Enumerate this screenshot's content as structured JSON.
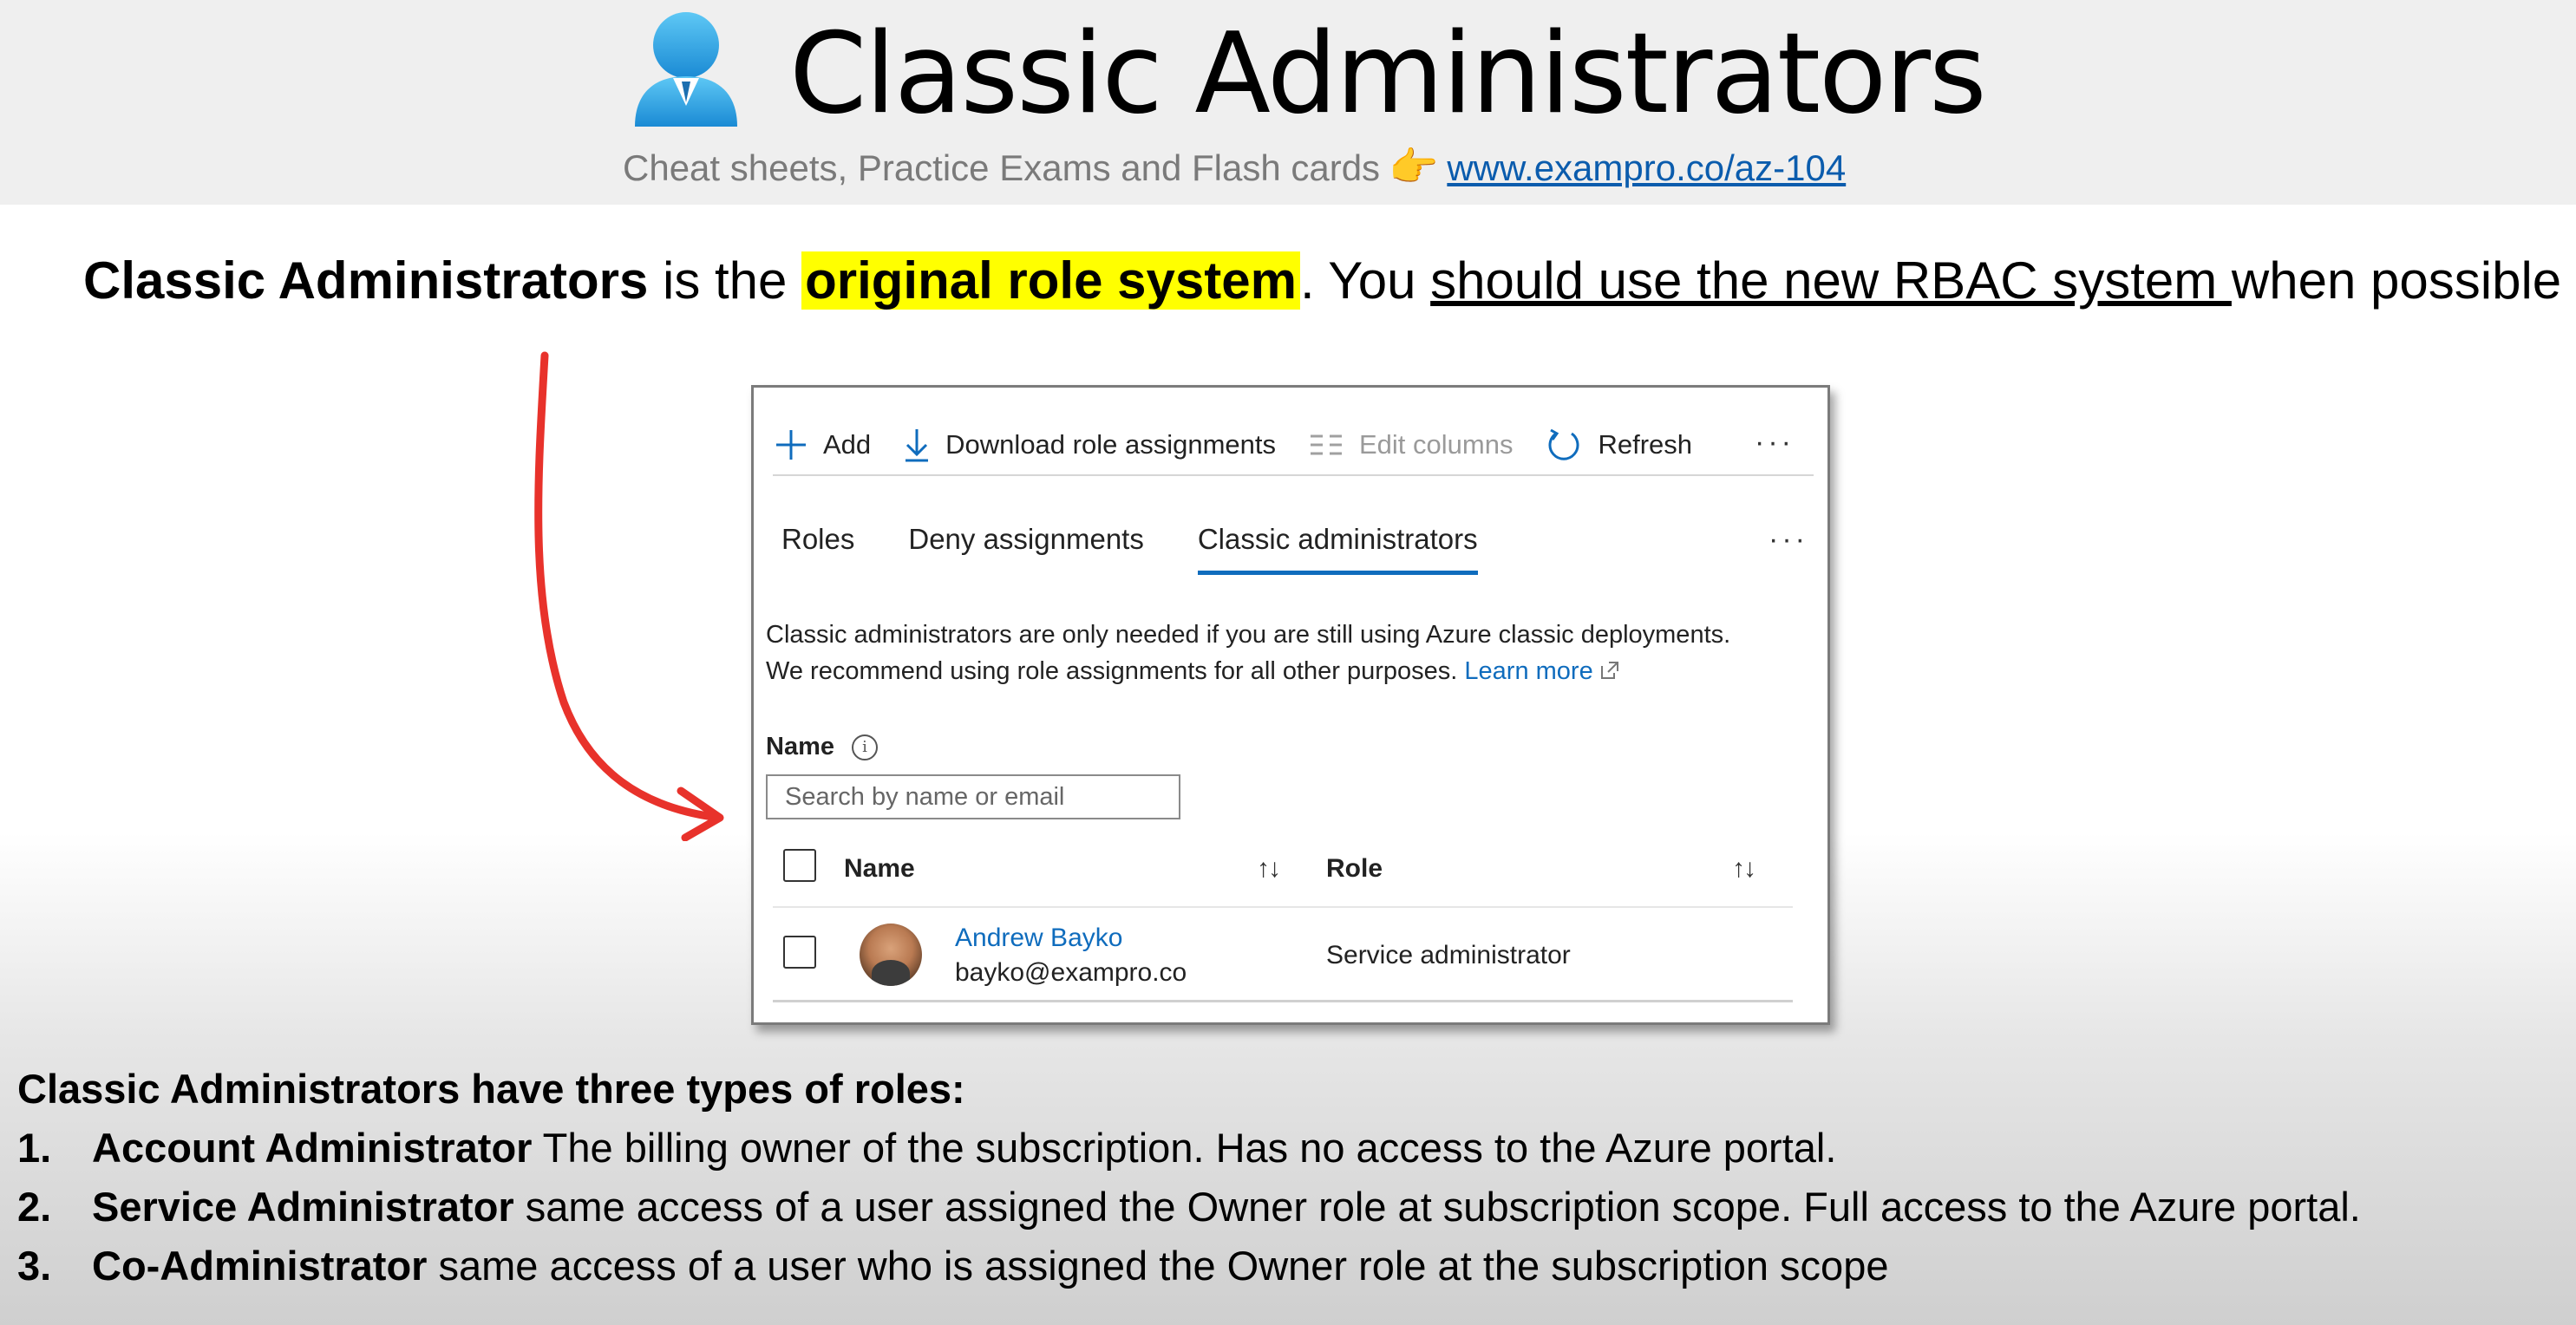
{
  "header": {
    "title": "Classic Administrators",
    "subtitle": "Cheat sheets, Practice Exams and Flash cards",
    "hand_emoji": "👉",
    "link": "www.exampro.co/az-104"
  },
  "headline": {
    "part1": "Classic Administrators",
    "part2": " is the ",
    "highlight": "original role system",
    "part3": ". You ",
    "underlined": "should use the new RBAC system ",
    "part4": "when possible"
  },
  "portal": {
    "toolbar": {
      "add": "Add",
      "download": "Download role assignments",
      "edit_columns": "Edit columns",
      "refresh": "Refresh",
      "more": "···"
    },
    "tabs": [
      "Roles",
      "Deny assignments",
      "Classic administrators"
    ],
    "tabs_more": "···",
    "notice_line1": "Classic administrators are only needed if you are still using Azure classic deployments.",
    "notice_line2": "We recommend using role assignments for all other purposes.",
    "learn_more": "Learn more",
    "filter_label": "Name",
    "search_placeholder": "Search by name or email",
    "columns": {
      "name": "Name",
      "role": "Role",
      "sort_glyph": "↑↓"
    },
    "rows": [
      {
        "name": "Andrew Bayko",
        "email": "bayko@exampro.co",
        "role": "Service administrator"
      }
    ]
  },
  "roles_list": {
    "lead": "Classic Administrators have three types of roles:",
    "items": [
      {
        "num": "1.",
        "title": "Account Administrator",
        "desc": "  The billing owner of the subscription. Has no access to the Azure portal."
      },
      {
        "num": "2.",
        "title": "Service Administrator",
        "desc": " same access of  a user assigned the Owner role at subscription scope. Full access to the Azure portal."
      },
      {
        "num": "3.",
        "title": "Co-Administrator",
        "desc": " same access of a user who is assigned the Owner role at the subscription scope"
      }
    ]
  },
  "colors": {
    "accent": "#0f6cbd",
    "highlight": "#ffff00",
    "arrow": "#e8322b"
  }
}
